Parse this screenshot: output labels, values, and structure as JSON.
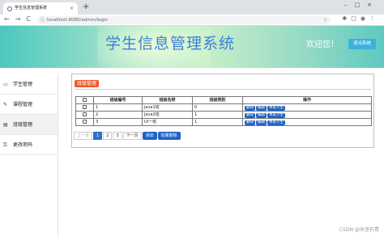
{
  "browser": {
    "tab_title": "学生信息管理系统",
    "close_glyph": "×",
    "newtab_glyph": "+",
    "window_controls": "–□×",
    "nav_glyphs": "←→C",
    "url": "localhost:8080/admin/login",
    "ext_glyphs": "✱□◉⋮"
  },
  "header": {
    "title": "学生信息管理系统",
    "welcome": "欢迎您！",
    "logout_label": "退出系统"
  },
  "sidebar": {
    "items": [
      {
        "label": "学生管理",
        "icon": "monitor-icon",
        "glyph": "▭"
      },
      {
        "label": "课程管理",
        "icon": "edit-icon",
        "glyph": "✎"
      },
      {
        "label": "班级管理",
        "icon": "document-icon",
        "glyph": "▤"
      },
      {
        "label": "更改密码",
        "icon": "key-icon",
        "glyph": "⚿"
      }
    ]
  },
  "panel": {
    "title": "班级管理",
    "columns": [
      "",
      "班级编号",
      "班级名称",
      "班级类别",
      "操作"
    ],
    "rows": [
      {
        "id": "1",
        "name": "java1班",
        "type": "0"
      },
      {
        "id": "2",
        "name": "Java2班",
        "type": "1"
      },
      {
        "id": "3",
        "name": "UI一班",
        "type": "1"
      }
    ],
    "row_actions": [
      "删除",
      "编辑",
      "本班学生"
    ],
    "pager": {
      "prev": "上一页",
      "pages": [
        "1",
        "2",
        "3"
      ],
      "current": "1",
      "next": "下一页",
      "add": "添加",
      "batch_delete": "批量删除"
    }
  },
  "watermark": "CSDN @水坚石青",
  "colors": {
    "accent": "#1e62c4",
    "title_badge": "#f05a28",
    "logout": "#3bb2dc",
    "banner_title": "#3b7fd8"
  }
}
